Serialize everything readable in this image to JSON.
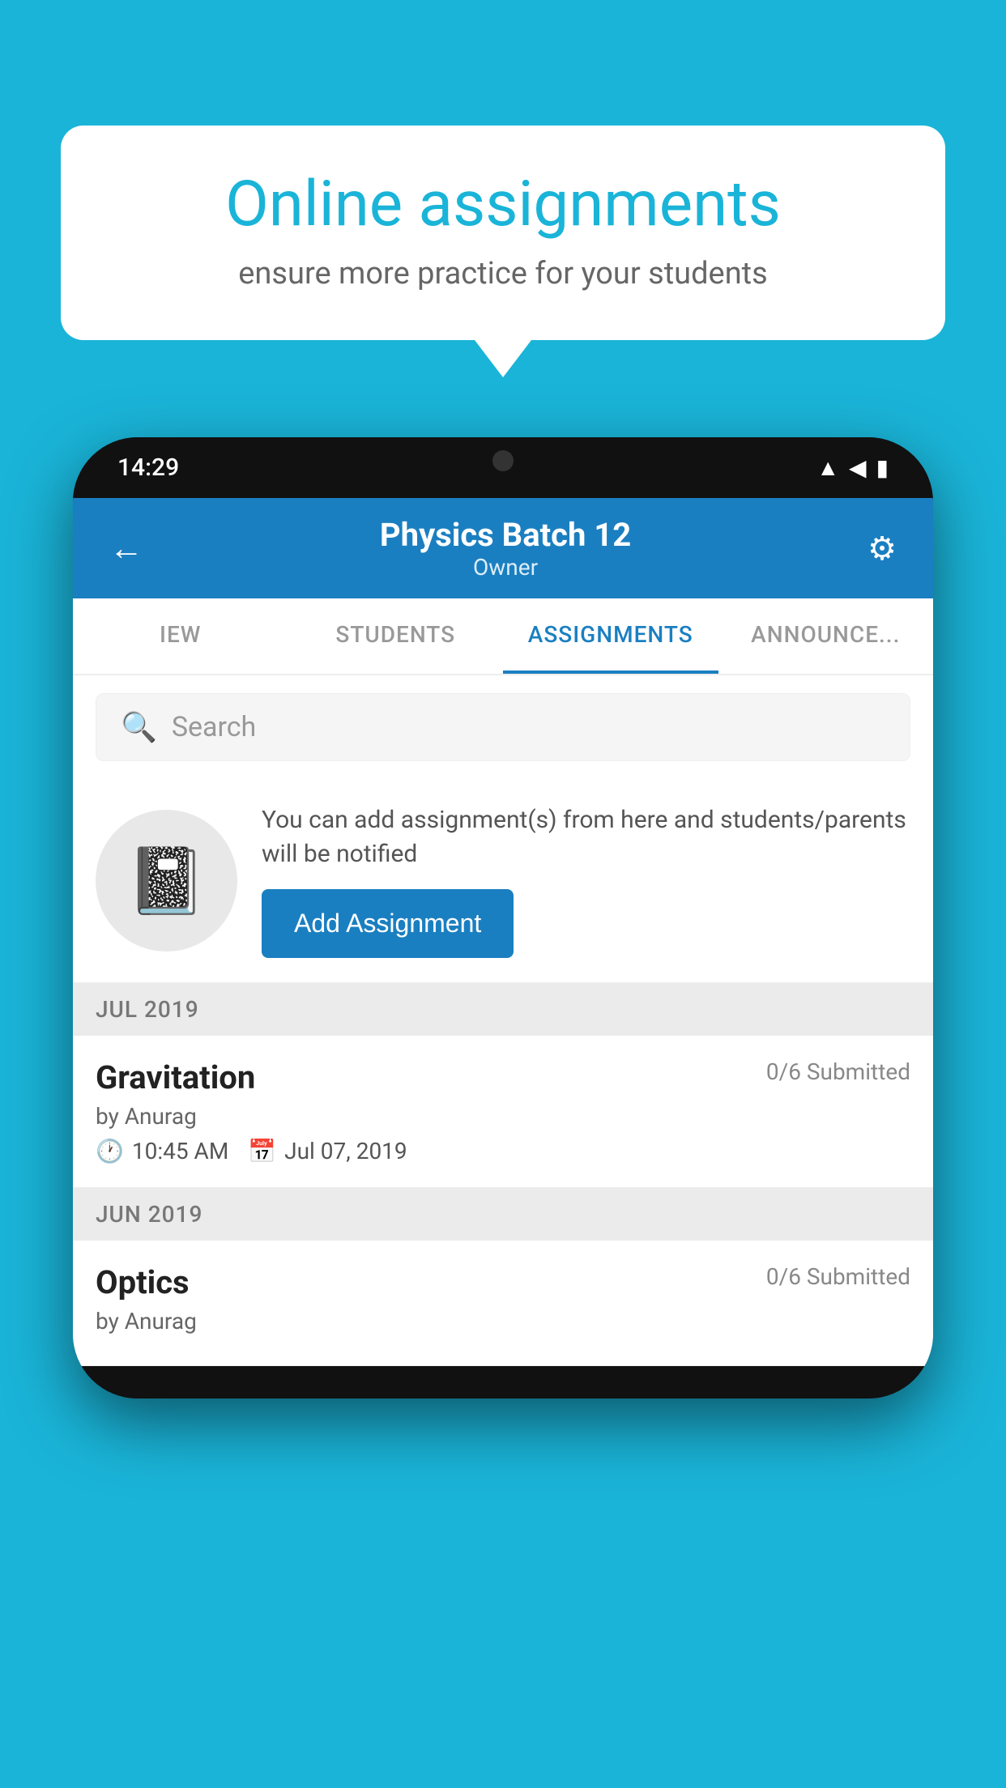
{
  "background_color": "#1ab4d8",
  "speech_bubble": {
    "title": "Online assignments",
    "subtitle": "ensure more practice for your students"
  },
  "phone": {
    "status_bar": {
      "time": "14:29",
      "wifi": "▲",
      "signal": "◀",
      "battery": "▮"
    },
    "app_bar": {
      "title": "Physics Batch 12",
      "subtitle": "Owner",
      "back_label": "←",
      "settings_label": "⚙"
    },
    "tabs": [
      {
        "label": "IEW",
        "active": false
      },
      {
        "label": "STUDENTS",
        "active": false
      },
      {
        "label": "ASSIGNMENTS",
        "active": true
      },
      {
        "label": "ANNOUNCEMENTS",
        "active": false
      }
    ],
    "search": {
      "placeholder": "Search"
    },
    "add_assignment": {
      "description": "You can add assignment(s) from here and students/parents will be notified",
      "button_label": "Add Assignment"
    },
    "sections": [
      {
        "month": "JUL 2019",
        "assignments": [
          {
            "name": "Gravitation",
            "submitted": "0/6 Submitted",
            "author": "by Anurag",
            "time": "10:45 AM",
            "date": "Jul 07, 2019"
          }
        ]
      },
      {
        "month": "JUN 2019",
        "assignments": [
          {
            "name": "Optics",
            "submitted": "0/6 Submitted",
            "author": "by Anurag",
            "time": "",
            "date": ""
          }
        ]
      }
    ]
  }
}
